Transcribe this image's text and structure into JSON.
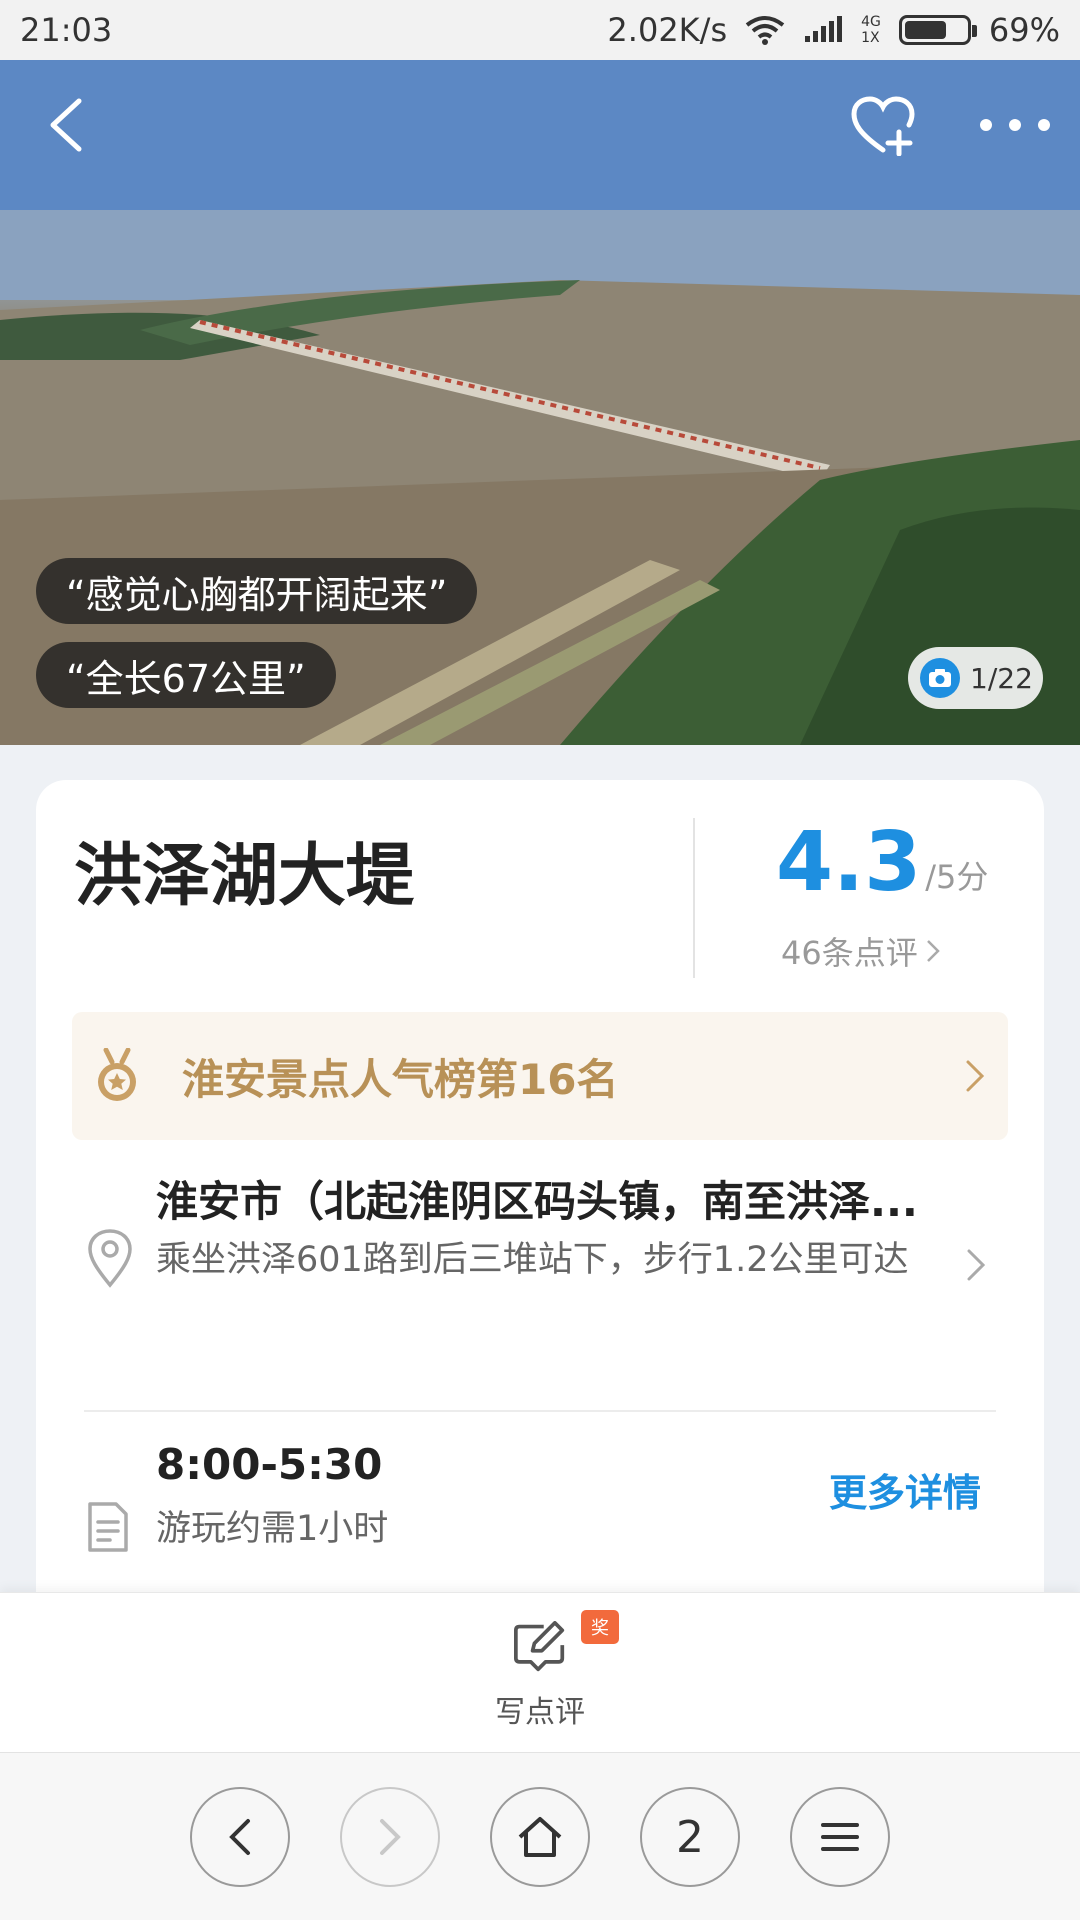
{
  "status_bar": {
    "time": "21:03",
    "net_speed": "2.02K/s",
    "net_type_top": "4G",
    "net_type_bottom": "1X",
    "battery": "69%",
    "battery_level": 0.69
  },
  "hero": {
    "quotes": [
      "“感觉心胸都开阔起来”",
      "“全长67公里”"
    ],
    "photo_counter": "1/22"
  },
  "poi": {
    "name": "洪泽湖大堤",
    "rating": "4.3",
    "rating_max": "/5分",
    "review_count": "46条点评",
    "rank_text": "淮安景点人气榜第16名",
    "address": "淮安市（北起淮阴区码头镇，南至洪泽...",
    "transport": "乘坐洪泽601路到后三堆站下，步行1.2公里可达",
    "hours": "8:00-5:30",
    "duration": "游玩约需1小时",
    "more_details": "更多详情"
  },
  "write_review": {
    "label": "写点评",
    "badge": "奖"
  },
  "nav": {
    "tab_count": "2"
  },
  "colors": {
    "accent": "#1e8fe0",
    "rank_gold": "#b89157",
    "reward": "#f26a3c"
  }
}
